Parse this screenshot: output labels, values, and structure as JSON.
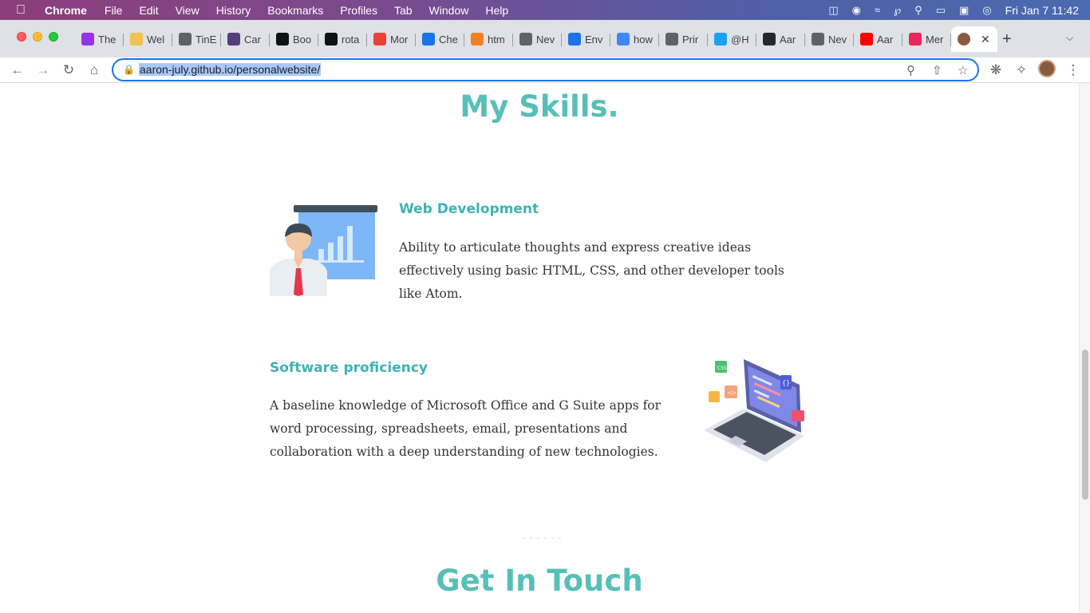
{
  "menubar": {
    "app_name": "Chrome",
    "items": [
      "File",
      "Edit",
      "View",
      "History",
      "Bookmarks",
      "Profiles",
      "Tab",
      "Window",
      "Help"
    ],
    "clock": "Fri Jan 7  11:42"
  },
  "tabs": [
    {
      "label": "The",
      "icon": "tab-favicon-purple",
      "color": "#9334e6"
    },
    {
      "label": "Wel",
      "icon": "tab-favicon-yellow",
      "color": "#f2c14e"
    },
    {
      "label": "TinE",
      "icon": "tab-favicon-globe",
      "color": "#5f6368"
    },
    {
      "label": "Car",
      "icon": "tab-favicon-b",
      "color": "#563d7c"
    },
    {
      "label": "Boo",
      "icon": "tab-favicon-c",
      "color": "#111111"
    },
    {
      "label": "rota",
      "icon": "tab-favicon-black",
      "color": "#111111"
    },
    {
      "label": "Mor",
      "icon": "tab-favicon-multi",
      "color": "#ea4335"
    },
    {
      "label": "Che",
      "icon": "tab-favicon-flag",
      "color": "#1a73e8"
    },
    {
      "label": "htm",
      "icon": "tab-favicon-stack",
      "color": "#f48024"
    },
    {
      "label": "Nev",
      "icon": "tab-favicon-chrome",
      "color": "#5f6368"
    },
    {
      "label": "Env",
      "icon": "tab-favicon-flag",
      "color": "#1a73e8"
    },
    {
      "label": "how",
      "icon": "tab-favicon-google",
      "color": "#4285f4"
    },
    {
      "label": "Prir",
      "icon": "tab-favicon-globe",
      "color": "#5f6368"
    },
    {
      "label": "@H",
      "icon": "tab-favicon-twitter",
      "color": "#1da1f2"
    },
    {
      "label": "Aar",
      "icon": "tab-favicon-github",
      "color": "#24292e"
    },
    {
      "label": "Nev",
      "icon": "tab-favicon-chrome",
      "color": "#5f6368"
    },
    {
      "label": "Aar",
      "icon": "tab-favicon-youtube",
      "color": "#ff0000"
    },
    {
      "label": "Mer",
      "icon": "tab-favicon-t",
      "color": "#e8275a"
    }
  ],
  "active_tab": {
    "label": "",
    "icon": "tab-favicon-avatar"
  },
  "address_bar": {
    "url": "aaron-july.github.io/personalwebsite/"
  },
  "page": {
    "skills_title": "My Skills.",
    "skills": [
      {
        "title": "Web Development",
        "text": "Ability to articulate thoughts and express creative ideas effectively using basic HTML, CSS, and other developer tools like Atom.",
        "illustration": "presenter-chart-illustration"
      },
      {
        "title": "Software proficiency",
        "text": "A baseline knowledge of Microsoft Office and G Suite apps for word processing, spreadsheets, email, presentations and collaboration with a deep understanding of new technologies.",
        "illustration": "laptop-code-illustration"
      }
    ],
    "divider": "• • • • • •",
    "contact_title": "Get In Touch"
  },
  "colors": {
    "accent": "#57bfb8",
    "heading_teal": "#3fb2b6",
    "url_highlight": "#a8c7fa",
    "focus_ring": "#1a73e8"
  }
}
